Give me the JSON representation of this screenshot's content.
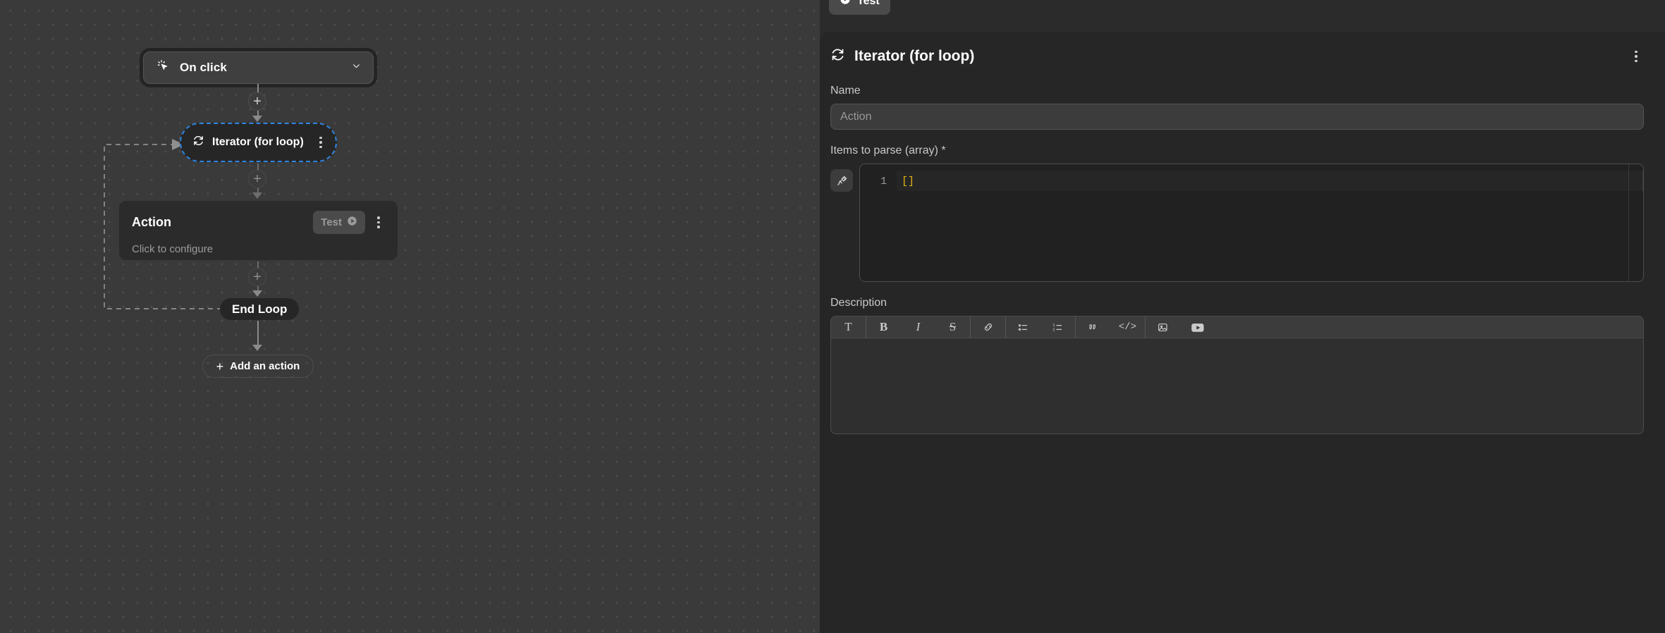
{
  "canvas": {
    "trigger": {
      "label": "On click",
      "icon": "cursor-click-icon",
      "chevron": "chevron-down-icon"
    },
    "iterator": {
      "label": "Iterator (for loop)",
      "icon": "loop-refresh-icon",
      "menu_icon": "kebab-menu-icon",
      "selected_outline_color": "#2f84e0"
    },
    "action": {
      "title": "Action",
      "subtitle": "Click to configure",
      "test_label": "Test",
      "test_icon": "play-circle-icon",
      "menu_icon": "kebab-menu-icon"
    },
    "end_loop": {
      "label": "End Loop"
    },
    "add_action": {
      "label": "Add an action",
      "icon": "plus-icon"
    },
    "connectors": {
      "add_icon": "plus-icon"
    }
  },
  "panel": {
    "top_test": {
      "label": "Test",
      "icon": "play-circle-icon"
    },
    "header": {
      "title": "Iterator (for loop)",
      "icon": "loop-refresh-icon",
      "menu_icon": "kebab-menu-icon"
    },
    "name": {
      "label": "Name",
      "value": "",
      "placeholder": "Action"
    },
    "items_to_parse": {
      "label": "Items to parse (array) *",
      "plug_icon": "plug-connector-icon",
      "line_number": "1",
      "code": "[]",
      "code_color": "#e2b714"
    },
    "description": {
      "label": "Description",
      "body": "",
      "toolbar": [
        {
          "name": "text-style-icon",
          "glyph": "T"
        },
        {
          "name": "bold-icon",
          "glyph": "B"
        },
        {
          "name": "italic-icon",
          "glyph": "I"
        },
        {
          "name": "strikethrough-icon",
          "glyph": "S"
        },
        {
          "name": "link-icon",
          "glyph": ""
        },
        {
          "name": "bullet-list-icon",
          "glyph": ""
        },
        {
          "name": "numbered-list-icon",
          "glyph": ""
        },
        {
          "name": "quote-icon",
          "glyph": ""
        },
        {
          "name": "code-icon",
          "glyph": "</>"
        },
        {
          "name": "image-icon",
          "glyph": ""
        },
        {
          "name": "video-icon",
          "glyph": ""
        }
      ]
    }
  }
}
